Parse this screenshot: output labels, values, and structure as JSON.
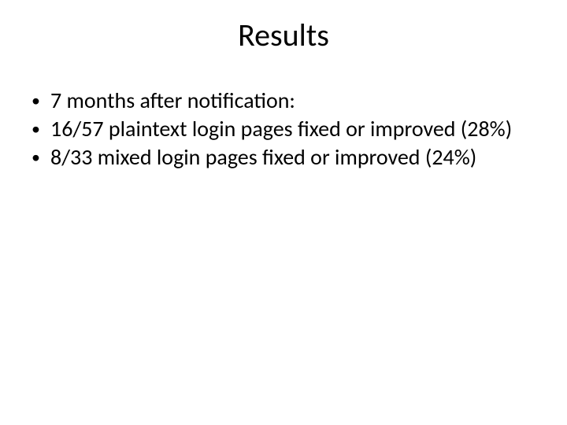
{
  "title": "Results",
  "bullets": [
    "7 months after notification:",
    "16/57 plaintext login pages fixed or improved (28%)",
    "8/33 mixed login pages fixed or improved (24%)"
  ]
}
